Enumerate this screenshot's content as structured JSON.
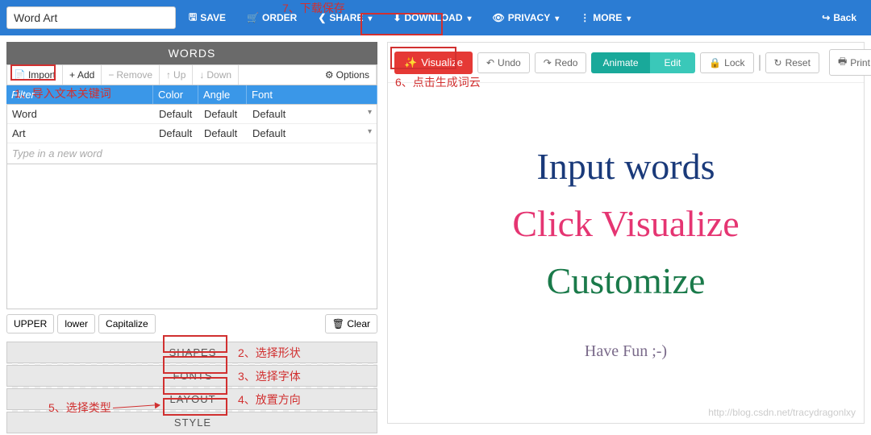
{
  "topbar": {
    "title_value": "Word Art",
    "save": "SAVE",
    "order": "ORDER",
    "share": "SHARE",
    "download": "DOWNLOAD",
    "privacy": "PRIVACY",
    "more": "MORE",
    "back": "Back"
  },
  "words_panel": {
    "header": "WORDS",
    "import": "Import",
    "add": "Add",
    "remove": "Remove",
    "up": "Up",
    "down": "Down",
    "options": "Options",
    "columns": {
      "word": "Filter",
      "color": "Color",
      "angle": "Angle",
      "font": "Font"
    },
    "rows": [
      {
        "word": "Word",
        "color": "Default",
        "angle": "Default",
        "font": "Default"
      },
      {
        "word": "Art",
        "color": "Default",
        "angle": "Default",
        "font": "Default"
      }
    ],
    "new_word_placeholder": "Type in a new word",
    "case": {
      "upper": "UPPER",
      "lower": "lower",
      "capitalize": "Capitalize",
      "clear": "Clear"
    },
    "tabs": {
      "shapes": "SHAPES",
      "fonts": "FONTS",
      "layout": "LAYOUT",
      "style": "STYLE"
    }
  },
  "right_toolbar": {
    "visualize": "Visualize",
    "undo": "Undo",
    "redo": "Redo",
    "animate": "Animate",
    "edit": "Edit",
    "lock": "Lock",
    "reset": "Reset",
    "print": "Print"
  },
  "canvas": {
    "line1": "Input words",
    "line2": "Click Visualize",
    "line3": "Customize",
    "fun": "Have Fun ;-)",
    "watermark": "http://blog.csdn.net/tracydragonlxy"
  },
  "annotations": {
    "a1": "1、导入文本关键词",
    "a2": "2、选择形状",
    "a3": "3、选择字体",
    "a4": "4、放置方向",
    "a5": "5、选择类型",
    "a6": "6、点击生成词云",
    "a7": "7、下载保存"
  }
}
